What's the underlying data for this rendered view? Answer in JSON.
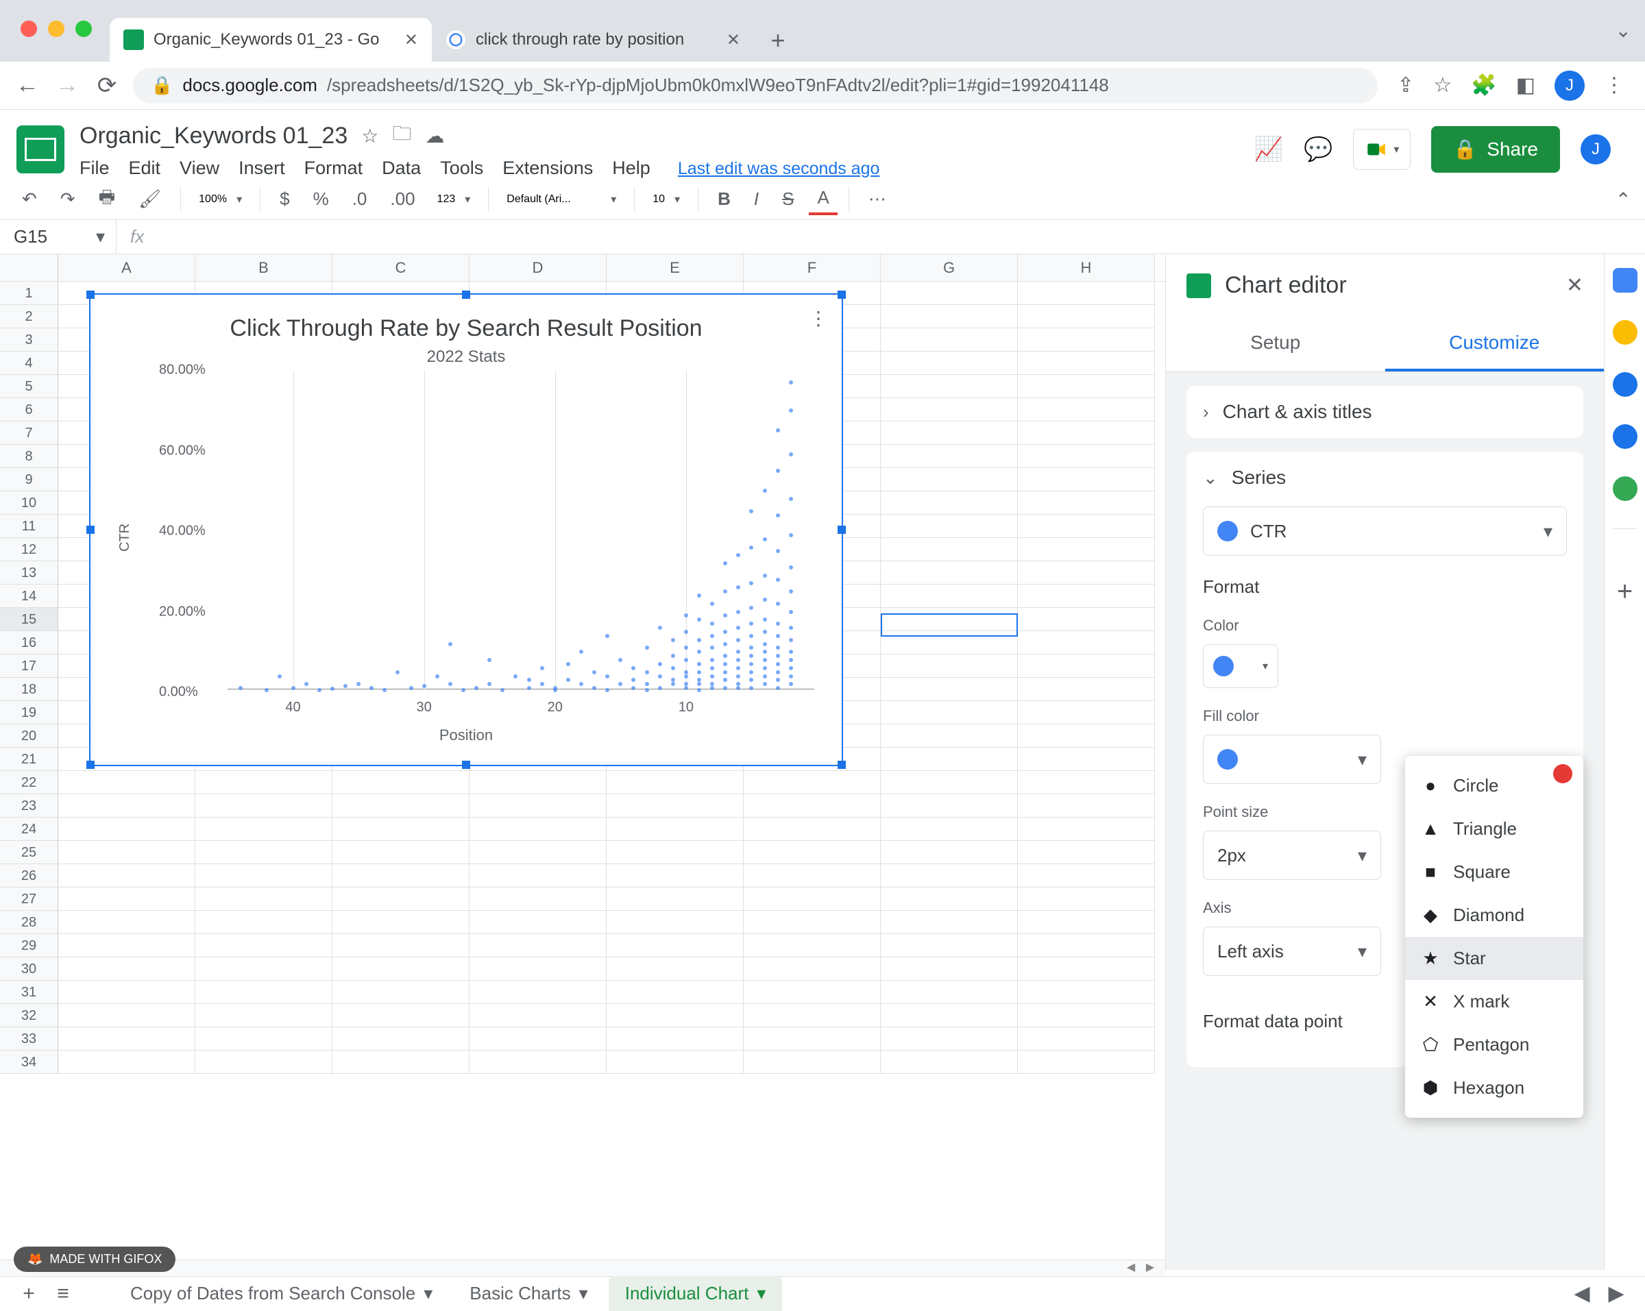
{
  "browser": {
    "tabs": [
      {
        "title": "Organic_Keywords 01_23 - Go",
        "favicon": "sheets"
      },
      {
        "title": "click through rate by position",
        "favicon": "google"
      }
    ],
    "url_host": "docs.google.com",
    "url_path": "/spreadsheets/d/1S2Q_yb_Sk-rYp-djpMjoUbm0k0mxlW9eoT9nFAdtv2l/edit?pli=1#gid=1992041148"
  },
  "doc": {
    "title": "Organic_Keywords 01_23",
    "last_edit": "Last edit was seconds ago",
    "menu": [
      "File",
      "Edit",
      "View",
      "Insert",
      "Format",
      "Data",
      "Tools",
      "Extensions",
      "Help"
    ],
    "share": "Share",
    "avatar": "J"
  },
  "toolbar": {
    "zoom": "100%",
    "currency": "$",
    "percent": "%",
    "dec_dec": ".0",
    "dec_inc": ".00",
    "fmt123": "123",
    "font": "Default (Ari...",
    "font_size": "10",
    "more": "⋯"
  },
  "namebox": "G15",
  "columns": [
    "A",
    "B",
    "C",
    "D",
    "E",
    "F",
    "G",
    "H"
  ],
  "rows": 34,
  "selected_cell": {
    "col": 6,
    "row": 15
  },
  "chart": {
    "title": "Click Through Rate by Search Result Position",
    "subtitle": "2022 Stats",
    "xlabel": "Position",
    "ylabel": "CTR",
    "y_ticks": [
      "0.00%",
      "20.00%",
      "40.00%",
      "60.00%",
      "80.00%"
    ],
    "x_ticks": [
      "40",
      "30",
      "20",
      "10"
    ]
  },
  "chart_data": {
    "type": "scatter",
    "title": "Click Through Rate by Search Result Position",
    "subtitle": "2022 Stats",
    "xlabel": "Position",
    "ylabel": "CTR",
    "xlim": [
      45,
      0
    ],
    "ylim": [
      0,
      80
    ],
    "series": [
      {
        "name": "CTR",
        "color": "#4285f4",
        "points_approx": [
          [
            44,
            1
          ],
          [
            42,
            0.5
          ],
          [
            41,
            4
          ],
          [
            40,
            1
          ],
          [
            39,
            2
          ],
          [
            38,
            0.5
          ],
          [
            37,
            0.8
          ],
          [
            36,
            1.5
          ],
          [
            35,
            2
          ],
          [
            34,
            1
          ],
          [
            33,
            0.5
          ],
          [
            32,
            5
          ],
          [
            31,
            1
          ],
          [
            30,
            1.5
          ],
          [
            29,
            4
          ],
          [
            28,
            12
          ],
          [
            28,
            2
          ],
          [
            27,
            0.5
          ],
          [
            26,
            1
          ],
          [
            25,
            2
          ],
          [
            25,
            8
          ],
          [
            24,
            0.5
          ],
          [
            23,
            4
          ],
          [
            22,
            3
          ],
          [
            22,
            1
          ],
          [
            21,
            6
          ],
          [
            21,
            2
          ],
          [
            20,
            1
          ],
          [
            20,
            0.5
          ],
          [
            19,
            3
          ],
          [
            19,
            7
          ],
          [
            18,
            2
          ],
          [
            18,
            10
          ],
          [
            17,
            1
          ],
          [
            17,
            5
          ],
          [
            16,
            0.5
          ],
          [
            16,
            4
          ],
          [
            16,
            14
          ],
          [
            15,
            2
          ],
          [
            15,
            8
          ],
          [
            14,
            1
          ],
          [
            14,
            3
          ],
          [
            14,
            6
          ],
          [
            13,
            2
          ],
          [
            13,
            5
          ],
          [
            13,
            11
          ],
          [
            13,
            0.5
          ],
          [
            12,
            1
          ],
          [
            12,
            4
          ],
          [
            12,
            7
          ],
          [
            12,
            16
          ],
          [
            11,
            2
          ],
          [
            11,
            3
          ],
          [
            11,
            6
          ],
          [
            11,
            9
          ],
          [
            11,
            13
          ],
          [
            10,
            1
          ],
          [
            10,
            2
          ],
          [
            10,
            4
          ],
          [
            10,
            5
          ],
          [
            10,
            8
          ],
          [
            10,
            11
          ],
          [
            10,
            15
          ],
          [
            10,
            19
          ],
          [
            9,
            0.5
          ],
          [
            9,
            2
          ],
          [
            9,
            3
          ],
          [
            9,
            5
          ],
          [
            9,
            7
          ],
          [
            9,
            10
          ],
          [
            9,
            13
          ],
          [
            9,
            18
          ],
          [
            9,
            24
          ],
          [
            8,
            1
          ],
          [
            8,
            2
          ],
          [
            8,
            4
          ],
          [
            8,
            6
          ],
          [
            8,
            8
          ],
          [
            8,
            11
          ],
          [
            8,
            14
          ],
          [
            8,
            17
          ],
          [
            8,
            22
          ],
          [
            7,
            1
          ],
          [
            7,
            3
          ],
          [
            7,
            5
          ],
          [
            7,
            7
          ],
          [
            7,
            9
          ],
          [
            7,
            12
          ],
          [
            7,
            15
          ],
          [
            7,
            19
          ],
          [
            7,
            25
          ],
          [
            7,
            32
          ],
          [
            6,
            1
          ],
          [
            6,
            2
          ],
          [
            6,
            4
          ],
          [
            6,
            6
          ],
          [
            6,
            8
          ],
          [
            6,
            10
          ],
          [
            6,
            13
          ],
          [
            6,
            16
          ],
          [
            6,
            20
          ],
          [
            6,
            26
          ],
          [
            6,
            34
          ],
          [
            5,
            1
          ],
          [
            5,
            3
          ],
          [
            5,
            5
          ],
          [
            5,
            7
          ],
          [
            5,
            9
          ],
          [
            5,
            11
          ],
          [
            5,
            14
          ],
          [
            5,
            17
          ],
          [
            5,
            21
          ],
          [
            5,
            27
          ],
          [
            5,
            36
          ],
          [
            5,
            45
          ],
          [
            4,
            2
          ],
          [
            4,
            4
          ],
          [
            4,
            6
          ],
          [
            4,
            8
          ],
          [
            4,
            10
          ],
          [
            4,
            12
          ],
          [
            4,
            15
          ],
          [
            4,
            18
          ],
          [
            4,
            23
          ],
          [
            4,
            29
          ],
          [
            4,
            38
          ],
          [
            4,
            50
          ],
          [
            3,
            1
          ],
          [
            3,
            3
          ],
          [
            3,
            5
          ],
          [
            3,
            7
          ],
          [
            3,
            9
          ],
          [
            3,
            11
          ],
          [
            3,
            14
          ],
          [
            3,
            17
          ],
          [
            3,
            22
          ],
          [
            3,
            28
          ],
          [
            3,
            35
          ],
          [
            3,
            44
          ],
          [
            3,
            55
          ],
          [
            3,
            65
          ],
          [
            2,
            2
          ],
          [
            2,
            4
          ],
          [
            2,
            6
          ],
          [
            2,
            8
          ],
          [
            2,
            10
          ],
          [
            2,
            13
          ],
          [
            2,
            16
          ],
          [
            2,
            20
          ],
          [
            2,
            25
          ],
          [
            2,
            31
          ],
          [
            2,
            39
          ],
          [
            2,
            48
          ],
          [
            2,
            59
          ],
          [
            2,
            70
          ],
          [
            2,
            77
          ]
        ]
      }
    ]
  },
  "editor": {
    "title": "Chart editor",
    "tabs": {
      "setup": "Setup",
      "customize": "Customize"
    },
    "sections": {
      "chart_axis": "Chart & axis titles",
      "series": "Series"
    },
    "series_dropdown": "CTR",
    "format_heading": "Format",
    "color_label": "Color",
    "fill_label": "Fill color",
    "point_size_label": "Point size",
    "point_size_value": "2px",
    "axis_label": "Axis",
    "axis_value": "Left axis",
    "fdp_label": "Format data point",
    "add": "Add",
    "shape_options": [
      "Circle",
      "Triangle",
      "Square",
      "Diamond",
      "Star",
      "X mark",
      "Pentagon",
      "Hexagon"
    ],
    "shape_selected": "Star"
  },
  "sheets": {
    "tabs": [
      "Copy of Dates from Search Console",
      "Basic Charts",
      "Individual Chart"
    ]
  },
  "watermark": "MADE WITH GIFOX"
}
